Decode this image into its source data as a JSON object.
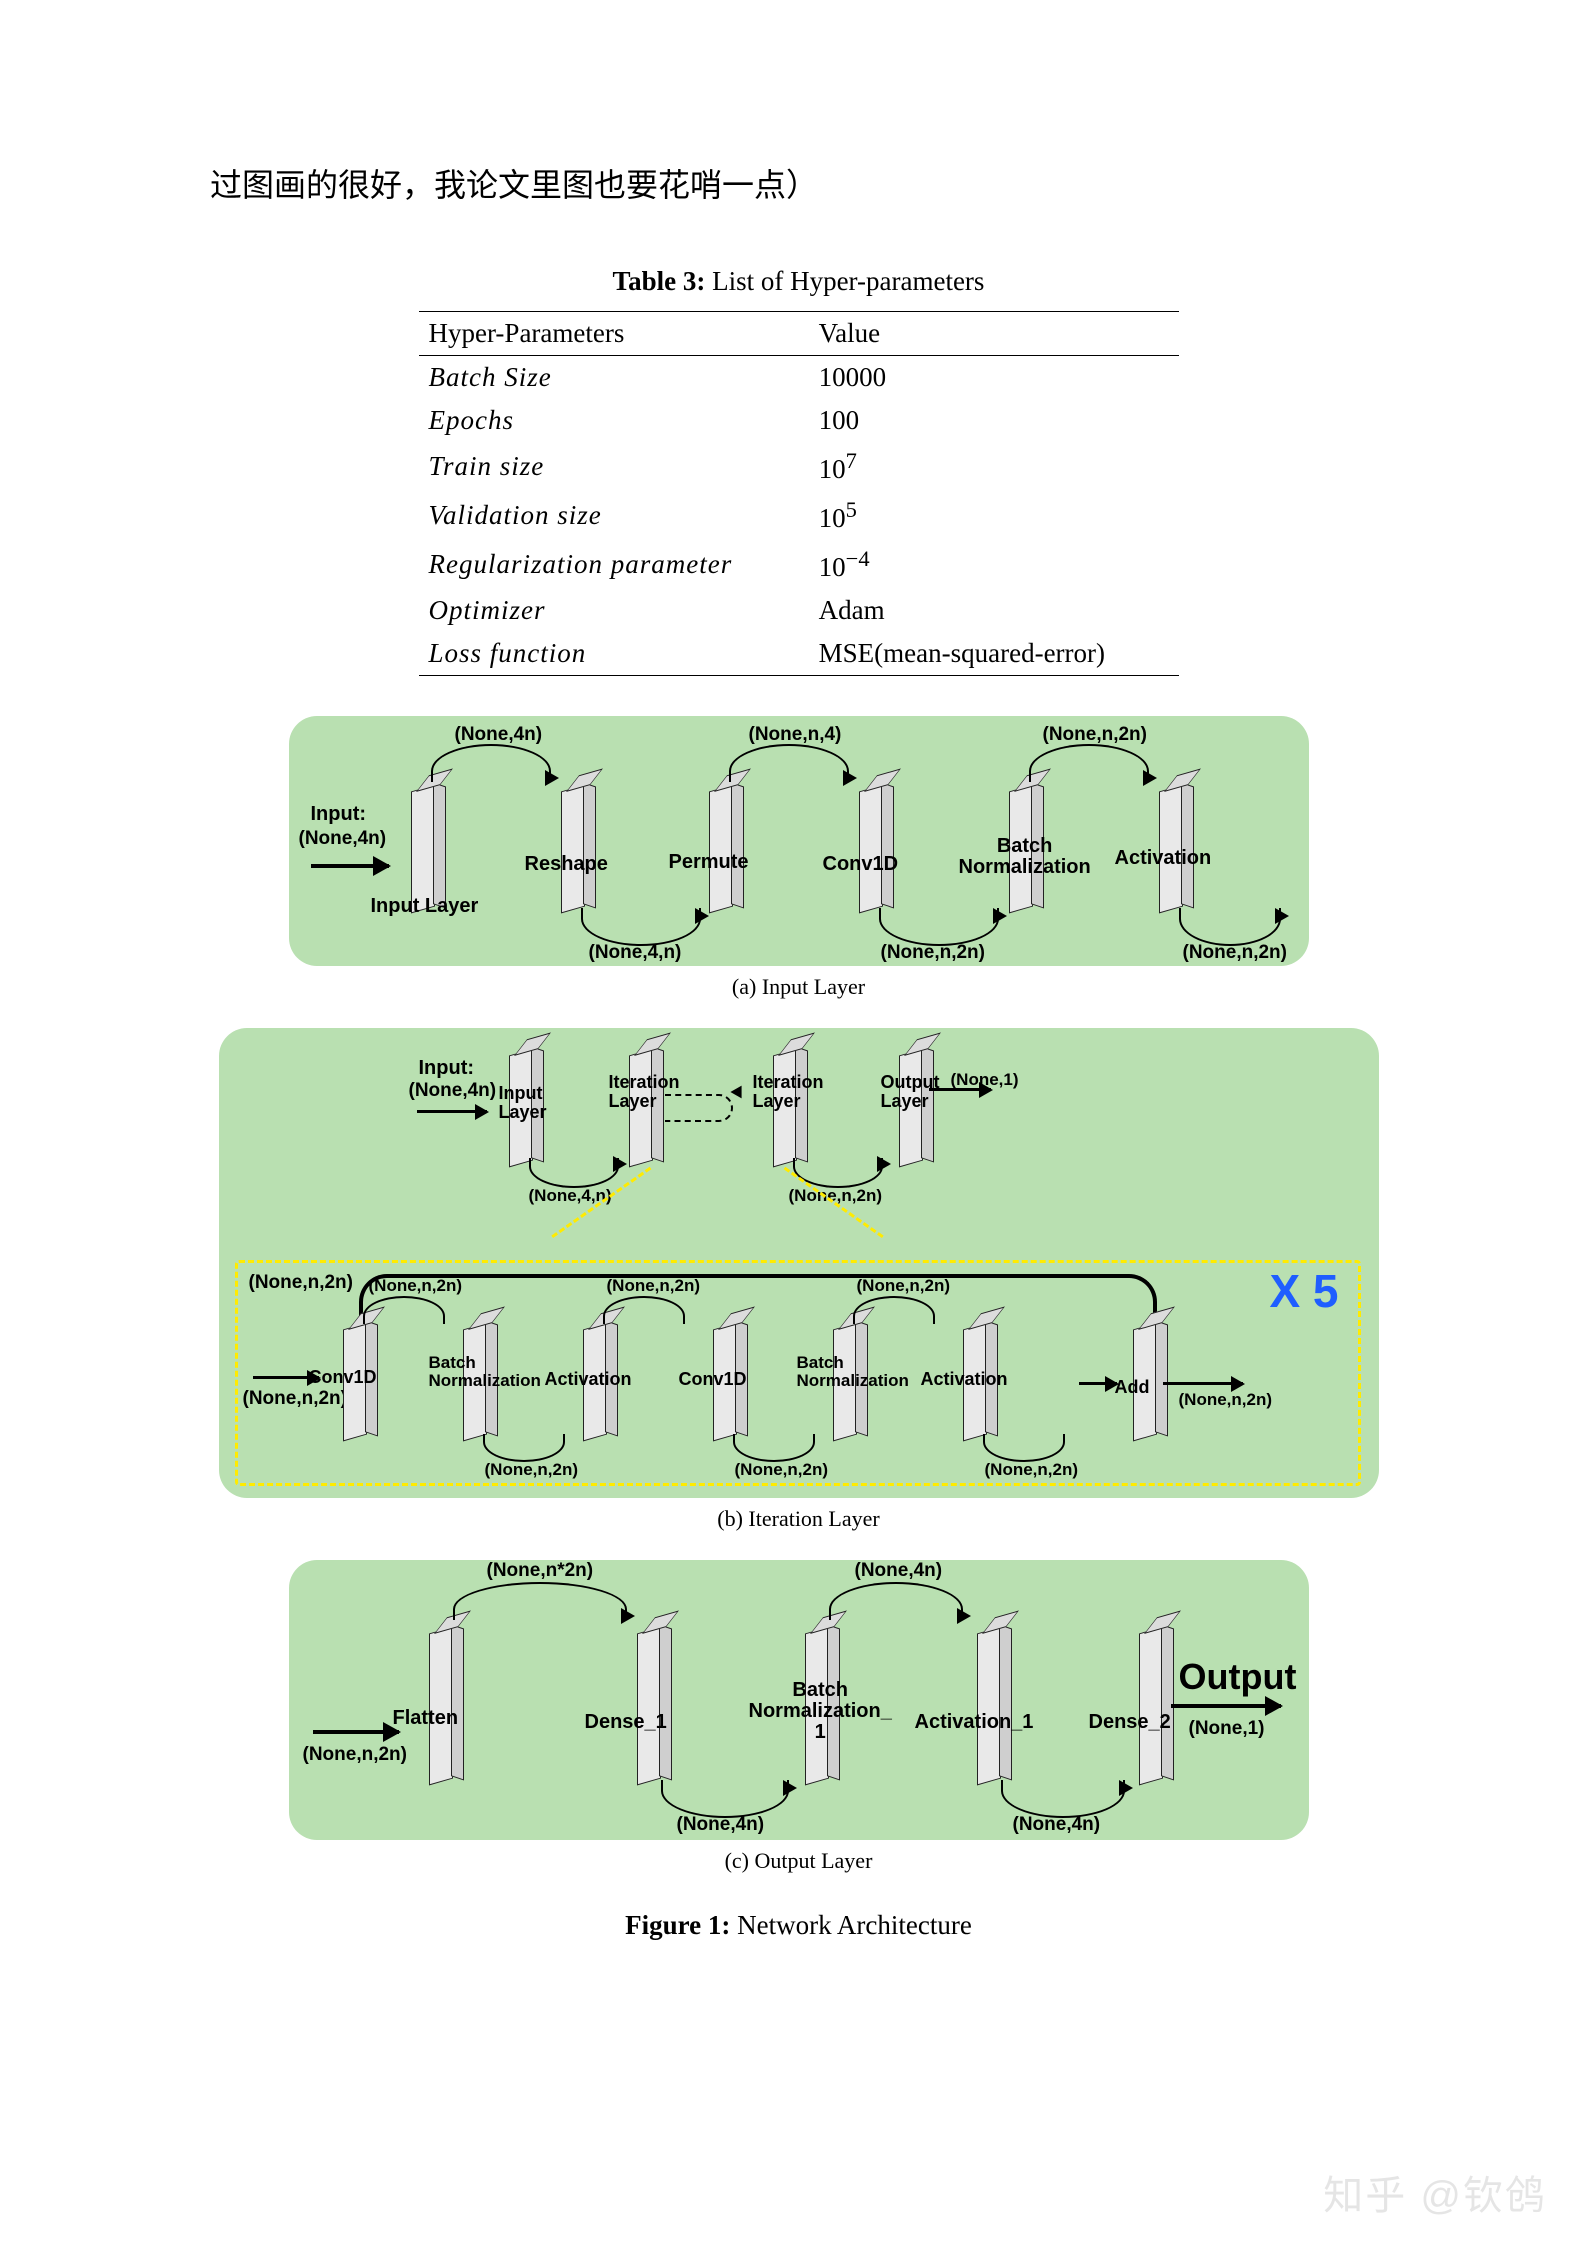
{
  "intro": "过图画的很好，我论文里图也要花哨一点）",
  "table": {
    "caption_strong": "Table 3:",
    "caption_rest": " List of Hyper-parameters",
    "header": {
      "col1": "Hyper-Parameters",
      "col2": "Value"
    },
    "rows": [
      {
        "param": "Batch    Size",
        "value_html": "10000"
      },
      {
        "param": "Epochs",
        "value_html": "100"
      },
      {
        "param": "Train     size",
        "value_html": "10^7"
      },
      {
        "param": "Validation    size",
        "value_html": "10^5"
      },
      {
        "param": "Regularization    parameter",
        "value_html": "10^-4"
      },
      {
        "param": "Optimizer",
        "value_html": "Adam"
      },
      {
        "param": "Loss    function",
        "value_html": "MSE(mean-squared-error)"
      }
    ]
  },
  "fig_a": {
    "caption": "(a) Input Layer",
    "input_label": "Input:",
    "input_shape": "(None,4n)",
    "blocks": [
      {
        "label": "Input Layer",
        "in_shape": "",
        "top_shape": "(None,4n)",
        "bottom_shape": ""
      },
      {
        "label": "Reshape",
        "top_shape": "",
        "bottom_shape": "(None,4,n)"
      },
      {
        "label": "Permute",
        "top_shape": "(None,n,4)",
        "bottom_shape": ""
      },
      {
        "label": "Conv1D",
        "top_shape": "",
        "bottom_shape": "(None,n,2n)"
      },
      {
        "label": "Batch\nNormalization",
        "top_shape": "(None,n,2n)",
        "bottom_shape": ""
      },
      {
        "label": "Activation",
        "top_shape": "",
        "bottom_shape": "(None,n,2n)"
      }
    ]
  },
  "fig_b": {
    "caption": "(b) Iteration Layer",
    "x5": "X 5",
    "top_input_label": "Input:",
    "top_input_shape": "(None,4n)",
    "top_blocks": [
      {
        "label": "Input\nLayer",
        "bottom_shape": "(None,4,n)"
      },
      {
        "label": "Iteration\nLayer",
        "bottom_shape": ""
      },
      {
        "label": "Iteration\nLayer",
        "bottom_shape": "(None,n,2n)"
      },
      {
        "label": "Output\nLayer",
        "right_shape": "(None,1)"
      }
    ],
    "inner_left_shapes": {
      "top": "(None,n,2n)",
      "bottom": "(None,n,2n)"
    },
    "inner_blocks": [
      {
        "label": "Conv1D",
        "top_shape": "(None,n,2n)",
        "bottom_shape": ""
      },
      {
        "label": "Batch\nNormalization",
        "top_shape": "",
        "bottom_shape": "(None,n,2n)"
      },
      {
        "label": "Activation",
        "top_shape": "(None,n,2n)",
        "bottom_shape": ""
      },
      {
        "label": "Conv1D",
        "top_shape": "",
        "bottom_shape": "(None,n,2n)"
      },
      {
        "label": "Batch\nNormalization",
        "top_shape": "(None,n,2n)",
        "bottom_shape": ""
      },
      {
        "label": "Activation",
        "top_shape": "",
        "bottom_shape": "(None,n,2n)"
      },
      {
        "label": "Add",
        "right_shape": "(None,n,2n)"
      }
    ]
  },
  "fig_c": {
    "caption": "(c) Output Layer",
    "input_shape": "(None,n,2n)",
    "output_text": "Output",
    "output_shape": "(None,1)",
    "blocks": [
      {
        "label": "Flatten",
        "top_shape": "(None,n*2n)",
        "bottom_shape": ""
      },
      {
        "label": "Dense_1",
        "top_shape": "",
        "bottom_shape": "(None,4n)"
      },
      {
        "label": "Batch\nNormalization_\n1",
        "top_shape": "(None,4n)",
        "bottom_shape": ""
      },
      {
        "label": "Activation_1",
        "top_shape": "",
        "bottom_shape": "(None,4n)"
      },
      {
        "label": "Dense_2"
      }
    ]
  },
  "figure": {
    "caption_strong": "Figure 1:",
    "caption_rest": " Network Architecture"
  },
  "watermark": "知乎 @钦鸧"
}
